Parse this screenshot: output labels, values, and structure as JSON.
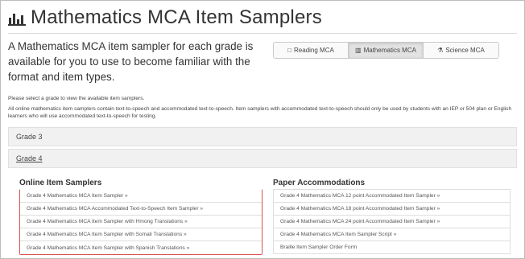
{
  "page": {
    "title": "Mathematics MCA Item Samplers",
    "title_icon": "bar-chart-icon"
  },
  "intro": {
    "text": "A Mathematics MCA item sampler for each grade is available for you to use to become familiar with the format and item types."
  },
  "subject_tabs": [
    {
      "label": "Reading MCA",
      "icon": "book-icon",
      "glyph": "□",
      "active": false
    },
    {
      "label": "Mathematics MCA",
      "icon": "bar-chart-icon",
      "glyph": "▥",
      "active": true
    },
    {
      "label": "Science MCA",
      "icon": "flask-icon",
      "glyph": "⚗",
      "active": false
    }
  ],
  "notes": {
    "select_grade": "Please select a grade to view the available item samplers.",
    "accommodated": "All online mathematics item samplers contain text-to-speech and accommodated text-to-speech. Item samplers with accommodated text-to-speech should only be used by students with an IEP or 504 plan or English learners who will use accommodated text-to-speech for testing."
  },
  "grades": {
    "grade3": "Grade 3",
    "grade4": "Grade 4"
  },
  "online": {
    "title": "Online Item Samplers",
    "items": [
      "Grade 4 Mathematics MCA Item Sampler »",
      "Grade 4 Mathematics MCA Accommodated Text-to-Speech Item Sampler »",
      "Grade 4 Mathematics MCA Item Sampler with Hmong Translations »",
      "Grade 4 Mathematics MCA Item Sampler with Somali Translations »",
      "Grade 4 Mathematics MCA Item Sampler with Spanish Translations »"
    ]
  },
  "paper": {
    "title": "Paper Accommodations",
    "items": [
      "Grade 4 Mathematics MCA 12 point Accommodated Item Sampler »",
      "Grade 4 Mathematics MCA 18 point Accommodated Item Sampler »",
      "Grade 4 Mathematics MCA 24 point Accommodated Item Sampler »",
      "Grade 4 Mathematics MCA Item Sampler Script »",
      "Braille Item Sampler Order Form"
    ]
  },
  "colors": {
    "highlight_border": "#d9534f",
    "panel_bg": "#f1f1f1"
  }
}
